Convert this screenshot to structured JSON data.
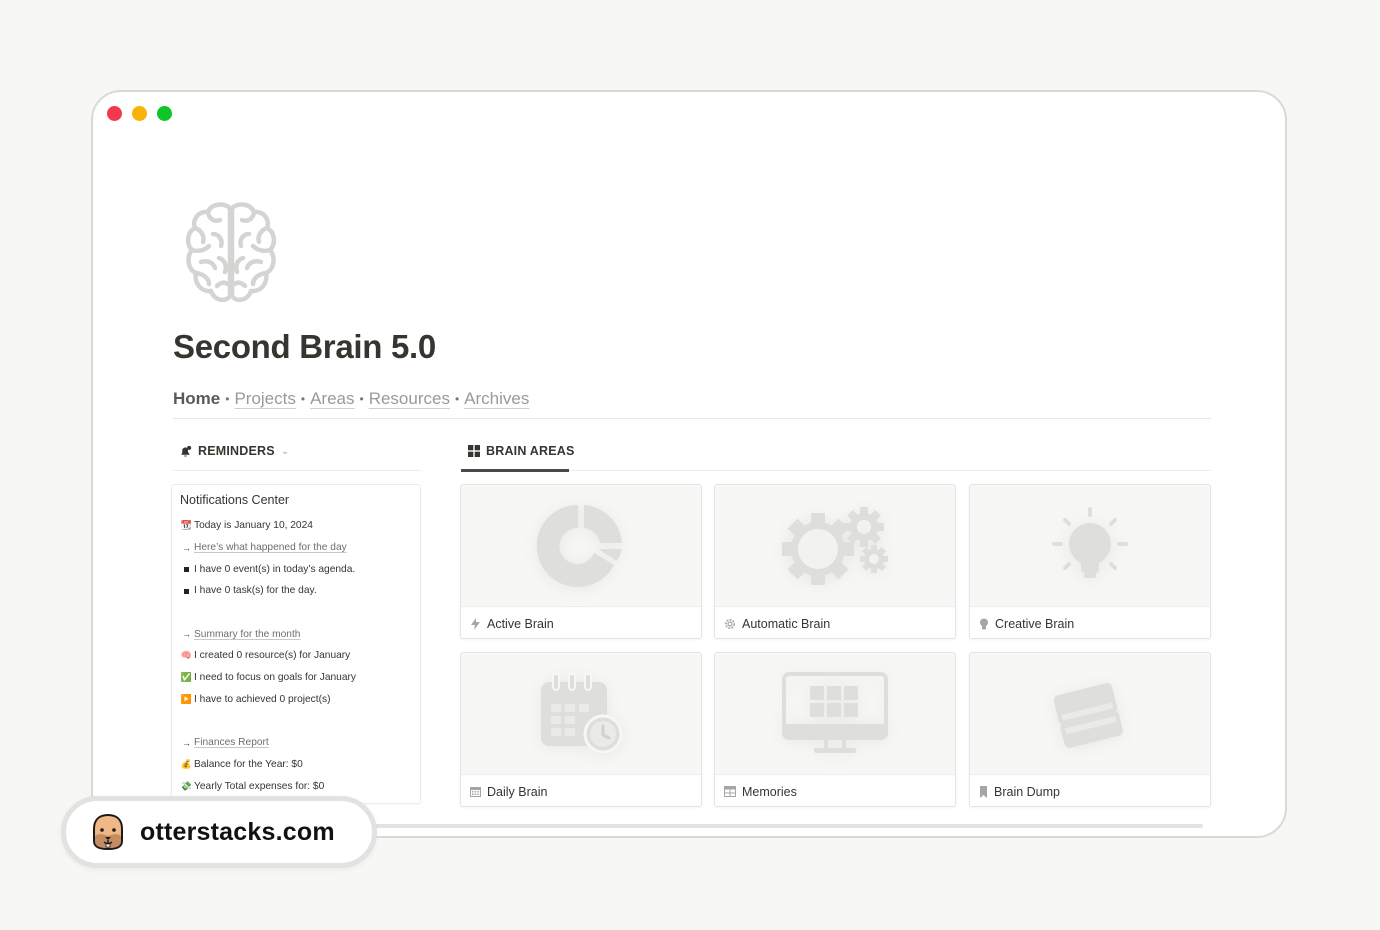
{
  "window": {
    "controls": [
      "close",
      "minimize",
      "zoom"
    ],
    "colors": {
      "close": "#f1394b",
      "minimize": "#f9b208",
      "zoom": "#0ec626"
    }
  },
  "page": {
    "icon": "brain-icon",
    "title": "Second Brain 5.0"
  },
  "breadcrumb": {
    "items": [
      {
        "label": "Home",
        "current": true
      },
      {
        "label": "Projects"
      },
      {
        "label": "Areas"
      },
      {
        "label": "Resources"
      },
      {
        "label": "Archives"
      }
    ],
    "separator": "•"
  },
  "reminders": {
    "heading": "REMINDERS",
    "icon": "bell-icon",
    "chevron": "⌄",
    "panel": {
      "title": "Notifications Center",
      "lines": [
        {
          "icon": "calendar-icon",
          "glyph": "📆",
          "text": "Today is January 10, 2024"
        },
        {
          "icon": "arrow-icon",
          "glyph": "→",
          "text": "Here’s what happened for the day",
          "link": true
        },
        {
          "icon": "square-bullet-icon",
          "glyph": "■",
          "text": "I have 0 event(s) in today’s agenda."
        },
        {
          "icon": "square-bullet-icon",
          "glyph": "■",
          "text": "I have 0 task(s) for the day."
        },
        {
          "icon": "arrow-icon",
          "glyph": "→",
          "text": "Summary for the month",
          "link": true
        },
        {
          "icon": "brain-emoji-icon",
          "glyph": "🧠",
          "text": "I created 0 resource(s) for January"
        },
        {
          "icon": "check-icon",
          "glyph": "✅",
          "text": "I need to focus on goals for January"
        },
        {
          "icon": "play-icon",
          "glyph": "▶️",
          "text": "I have to achieved 0 project(s)"
        },
        {
          "icon": "arrow-icon",
          "glyph": "→",
          "text": "Finances Report",
          "link": true
        },
        {
          "icon": "money-bag-icon",
          "glyph": "💰",
          "text": "Balance for the Year: $0"
        },
        {
          "icon": "money-wings-icon",
          "glyph": "💸",
          "text": "Yearly Total expenses for: $0"
        }
      ]
    }
  },
  "brain_areas": {
    "heading": "BRAIN AREAS",
    "icon": "gallery-icon",
    "cards": [
      {
        "label": "Active Brain",
        "icon": "lightning-icon",
        "cover": "pie-chart-cover"
      },
      {
        "label": "Automatic Brain",
        "icon": "gear-icon",
        "cover": "gears-cover"
      },
      {
        "label": "Creative Brain",
        "icon": "lightbulb-icon",
        "cover": "lightbulb-cover"
      },
      {
        "label": "Daily Brain",
        "icon": "calendar-icon",
        "cover": "calendar-clock-cover"
      },
      {
        "label": "Memories",
        "icon": "table-icon",
        "cover": "monitor-cover"
      },
      {
        "label": "Brain Dump",
        "icon": "bookmark-icon",
        "cover": "books-cover"
      }
    ]
  },
  "watermark": {
    "site": "otterstacks.com",
    "icon": "otter-face-icon"
  }
}
